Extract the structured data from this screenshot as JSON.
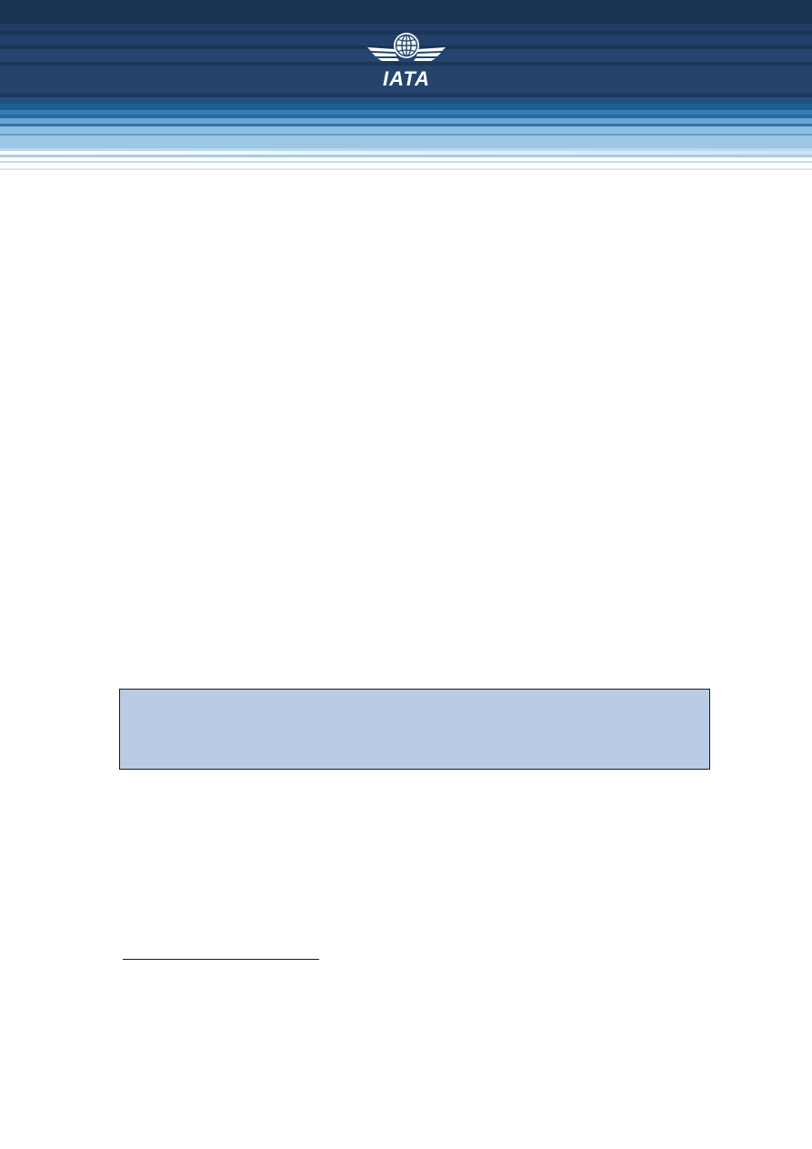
{
  "header": {
    "logo_text": "IATA",
    "colors": {
      "banner_dark": "#1b3353",
      "banner_mid": "#24446e",
      "banner_light": "#9cc7e6"
    }
  },
  "callout_box": {
    "text": "",
    "fill_color": "#b9cce4"
  },
  "footnotes": {
    "text": ""
  }
}
